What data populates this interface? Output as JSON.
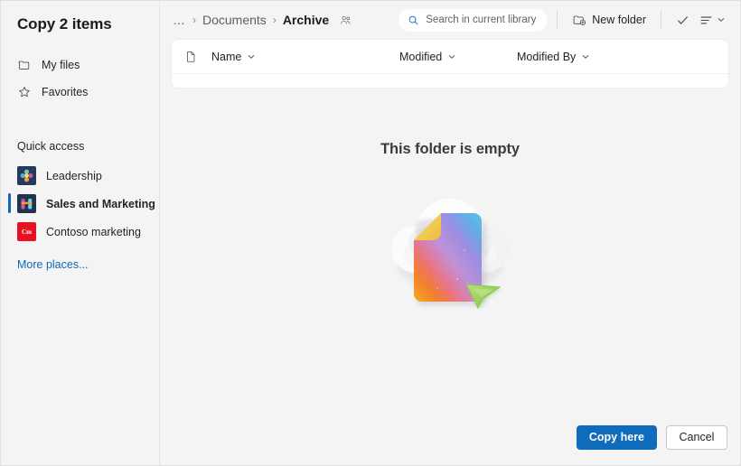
{
  "dialog": {
    "title": "Copy 2 items"
  },
  "sidebar": {
    "nav": [
      {
        "label": "My files",
        "icon": "folder-icon"
      },
      {
        "label": "Favorites",
        "icon": "star-icon"
      }
    ],
    "section_label": "Quick access",
    "quick_access": [
      {
        "label": "Leadership",
        "icon": "site-icon-leadership",
        "selected": false
      },
      {
        "label": "Sales and Marketing",
        "icon": "site-icon-sales-and-marketing",
        "selected": true
      },
      {
        "label": "Contoso marketing",
        "icon": "site-icon-contoso-marketing",
        "badge": "Cm",
        "selected": false
      }
    ],
    "more_places": "More places..."
  },
  "commandbar": {
    "breadcrumb": [
      {
        "label": "…",
        "type": "ellipsis"
      },
      {
        "label": "Documents",
        "type": "link"
      },
      {
        "label": "Archive",
        "type": "current",
        "shared": true
      }
    ],
    "separator": "›",
    "search": {
      "placeholder": "Search in current library",
      "value": "",
      "icon": "search-icon"
    },
    "new_folder": {
      "label": "New folder",
      "icon": "new-folder-icon"
    },
    "select_all": {
      "icon": "checkmark-icon"
    },
    "view_options": {
      "icon": "list-view-icon",
      "chevron": "chevron-down-icon"
    }
  },
  "list": {
    "columns": [
      {
        "label": "",
        "icon": "file-type-icon",
        "sortable": false
      },
      {
        "label": "Name",
        "chevron": "chevron-down-icon",
        "sortable": true
      },
      {
        "label": "Modified",
        "chevron": "chevron-down-icon",
        "sortable": true
      },
      {
        "label": "Modified By",
        "chevron": "chevron-down-icon",
        "sortable": true
      }
    ],
    "rows": []
  },
  "empty_state": {
    "message": "This folder is empty",
    "illustration": "empty-folder-cloud-document-illustration"
  },
  "footer": {
    "primary_label": "Copy here",
    "secondary_label": "Cancel"
  },
  "colors": {
    "accent": "#0f6cbd",
    "link": "#1267b4",
    "selection_bar": "#1267b4",
    "background": "#f4f4f4",
    "card": "#ffffff",
    "text": "#242424",
    "muted_text": "#616161",
    "contoso_red": "#e81123",
    "site_navy": "#243a5e"
  }
}
